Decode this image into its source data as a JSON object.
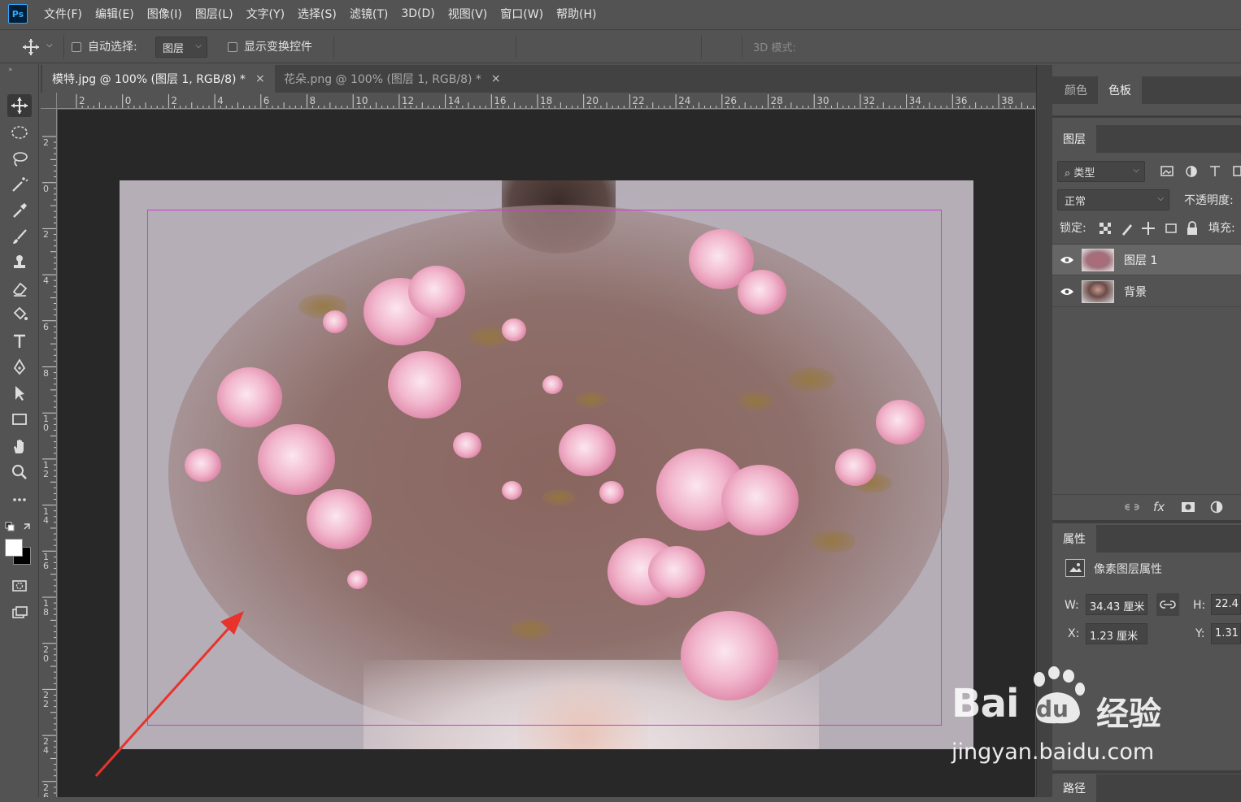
{
  "app": {
    "logo": "Ps"
  },
  "menu": [
    "文件(F)",
    "编辑(E)",
    "图像(I)",
    "图层(L)",
    "文字(Y)",
    "选择(S)",
    "滤镜(T)",
    "3D(D)",
    "视图(V)",
    "窗口(W)",
    "帮助(H)"
  ],
  "options": {
    "auto_select_label": "自动选择:",
    "auto_select_target": "图层",
    "show_transform_label": "显示变换控件",
    "mode_3d_label": "3D 模式:"
  },
  "tabs": [
    {
      "label": "模特.jpg @ 100% (图层 1, RGB/8) *",
      "close": "×",
      "active": true
    },
    {
      "label": "花朵.png @ 100% (图层 1, RGB/8) *",
      "close": "×",
      "active": false
    }
  ],
  "rulers": {
    "h_labels": [
      "2",
      "0",
      "2",
      "4",
      "6",
      "8",
      "10",
      "12",
      "14",
      "16",
      "18",
      "20",
      "22",
      "24",
      "26",
      "28",
      "30",
      "32",
      "34",
      "36",
      "38"
    ],
    "v_labels": [
      "2",
      "0",
      "2",
      "4",
      "6",
      "8",
      "10",
      "12",
      "14",
      "16",
      "18",
      "20",
      "22",
      "24",
      "26"
    ]
  },
  "panels": {
    "top_tabs": [
      "颜色",
      "色板"
    ],
    "layers_tab": "图层",
    "filter_kind": "类型",
    "blend_mode": "正常",
    "opacity_label": "不透明度:",
    "lock_label": "锁定:",
    "fill_label": "填充:",
    "layers": [
      {
        "name": "图层 1",
        "selected": true
      },
      {
        "name": "背景",
        "selected": false
      }
    ],
    "footer_fx": "fx",
    "properties_tab": "属性",
    "properties_title": "像素图层属性",
    "props": {
      "w_label": "W:",
      "w_value": "34.43 厘米",
      "h_label": "H:",
      "h_value": "22.4",
      "x_label": "X:",
      "x_value": "1.23 厘米",
      "y_label": "Y:",
      "y_value": "1.31"
    },
    "paths_tab": "路径"
  },
  "watermark": {
    "brand": "Bai",
    "brand2": "du",
    "cn": "经验",
    "url": "jingyan.baidu.com"
  },
  "colors": {
    "accent_guide": "#d03ad0",
    "arrow": "#e8332d",
    "ps_blue": "#31a8ff"
  }
}
